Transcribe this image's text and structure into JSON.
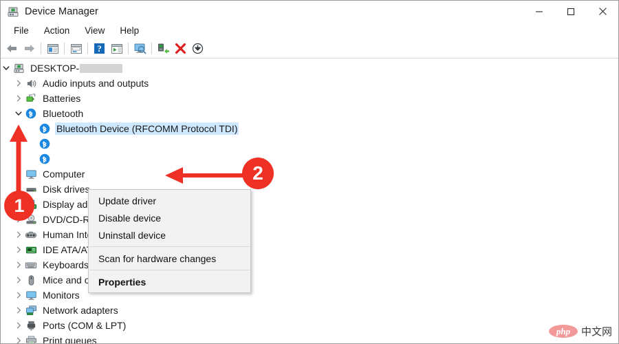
{
  "window": {
    "title": "Device Manager",
    "icon": "device-manager-icon",
    "controls": {
      "minimize": "–",
      "maximize": "□",
      "close": "✕"
    }
  },
  "menubar": {
    "items": [
      {
        "label": "File"
      },
      {
        "label": "Action"
      },
      {
        "label": "View"
      },
      {
        "label": "Help"
      }
    ]
  },
  "toolbar": {
    "items": [
      {
        "name": "back-icon"
      },
      {
        "name": "forward-icon"
      },
      {
        "name": "separator"
      },
      {
        "name": "show-hide-console-tree-icon"
      },
      {
        "name": "separator"
      },
      {
        "name": "properties-icon"
      },
      {
        "name": "separator"
      },
      {
        "name": "help-icon"
      },
      {
        "name": "update-driver-icon"
      },
      {
        "name": "separator"
      },
      {
        "name": "scan-for-hardware-changes-icon"
      },
      {
        "name": "separator"
      },
      {
        "name": "enable-device-icon"
      },
      {
        "name": "uninstall-device-icon"
      },
      {
        "name": "download-icon"
      }
    ]
  },
  "tree": {
    "root": {
      "label": "DESKTOP-",
      "icon": "computer-icon",
      "expanded": true,
      "redacted": true
    },
    "nodes": [
      {
        "label": "Audio inputs and outputs",
        "icon": "speaker-icon",
        "expanded": false,
        "indent": 1
      },
      {
        "label": "Batteries",
        "icon": "battery-icon",
        "expanded": false,
        "indent": 1
      },
      {
        "label": "Bluetooth",
        "icon": "bluetooth-icon",
        "expanded": true,
        "indent": 1
      },
      {
        "label": "Bluetooth Device (RFCOMM Protocol TDI)",
        "icon": "bluetooth-icon",
        "indent": 2,
        "selected": true
      },
      {
        "label": "",
        "icon": "bluetooth-icon",
        "indent": 2
      },
      {
        "label": "",
        "icon": "bluetooth-icon",
        "indent": 2
      },
      {
        "label": "Computer",
        "icon": "monitor-icon",
        "expanded": false,
        "indent": 1,
        "truncate": "Cor"
      },
      {
        "label": "Disk drives",
        "icon": "disk-icon",
        "expanded": false,
        "indent": 1,
        "truncate": "Disk"
      },
      {
        "label": "Display adapters",
        "icon": "display-adapter-icon",
        "expanded": false,
        "indent": 1,
        "truncate": "Disp"
      },
      {
        "label": "DVD/CD-ROM drives",
        "icon": "dvd-icon",
        "expanded": false,
        "indent": 1,
        "truncate": "DVD"
      },
      {
        "label": "Human Interface Devices",
        "icon": "hid-icon",
        "expanded": false,
        "indent": 1
      },
      {
        "label": "IDE ATA/ATAPI controllers",
        "icon": "ide-controller-icon",
        "expanded": false,
        "indent": 1
      },
      {
        "label": "Keyboards",
        "icon": "keyboard-icon",
        "expanded": false,
        "indent": 1
      },
      {
        "label": "Mice and other pointing devices",
        "icon": "mouse-icon",
        "expanded": false,
        "indent": 1
      },
      {
        "label": "Monitors",
        "icon": "monitor-icon",
        "expanded": false,
        "indent": 1
      },
      {
        "label": "Network adapters",
        "icon": "network-adapter-icon",
        "expanded": false,
        "indent": 1
      },
      {
        "label": "Ports (COM & LPT)",
        "icon": "port-icon",
        "expanded": false,
        "indent": 1
      },
      {
        "label": "Print queues",
        "icon": "printer-icon",
        "expanded": false,
        "indent": 1
      }
    ]
  },
  "context_menu": {
    "items": [
      {
        "label": "Update driver",
        "bold": false,
        "separator_after": false
      },
      {
        "label": "Disable device",
        "bold": false,
        "separator_after": false
      },
      {
        "label": "Uninstall device",
        "bold": false,
        "separator_after": true
      },
      {
        "label": "Scan for hardware changes",
        "bold": false,
        "separator_after": true
      },
      {
        "label": "Properties",
        "bold": true,
        "separator_after": false
      }
    ]
  },
  "annotations": {
    "color": "#ee3124",
    "markers": [
      {
        "label": "1",
        "name": "step-1-badge"
      },
      {
        "label": "2",
        "name": "step-2-badge"
      }
    ]
  },
  "watermark": {
    "brand": "php",
    "text": "中文网"
  }
}
